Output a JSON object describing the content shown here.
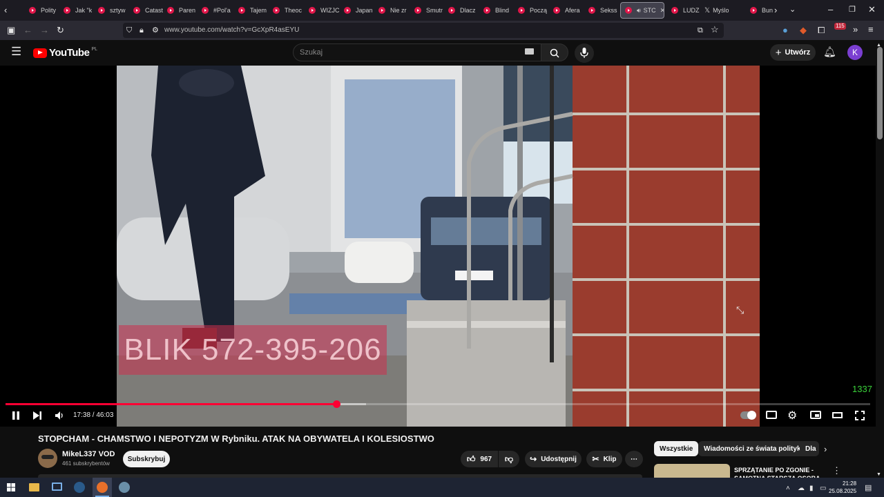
{
  "browser": {
    "tabs": [
      {
        "label": "Polity"
      },
      {
        "label": "Jak \"k"
      },
      {
        "label": "sztyw"
      },
      {
        "label": "Catast"
      },
      {
        "label": "Paren"
      },
      {
        "label": "#Pol'a"
      },
      {
        "label": "Tajem"
      },
      {
        "label": "Theoc"
      },
      {
        "label": "WIZJC"
      },
      {
        "label": "Japan"
      },
      {
        "label": "Nie zr"
      },
      {
        "label": "Smutr"
      },
      {
        "label": "Dlacz"
      },
      {
        "label": "Blind"
      },
      {
        "label": "Począ"
      },
      {
        "label": "Afera"
      },
      {
        "label": "Sekss"
      },
      {
        "label": "STC",
        "active": true
      },
      {
        "label": "LUDZ"
      },
      {
        "label": "Myślo"
      },
      {
        "label": "Bun"
      }
    ],
    "url": "www.youtube.com/watch?v=GcXpR4asEYU",
    "extension_badge": "115"
  },
  "youtube": {
    "logo_text": "YouTube",
    "logo_region": "PL",
    "search_placeholder": "Szukaj",
    "create_label": "Utwórz",
    "avatar_letter": "K"
  },
  "player": {
    "overlay_text": "BLIK 572-395-206",
    "corner_text": "1337",
    "current_time": "17:38",
    "duration": "46:03",
    "time_display": "17:38 / 46:03",
    "progress_fraction": 0.383,
    "buffered_fraction": 0.417
  },
  "video": {
    "title": "STOPCHAM - CHAMSTWO I NEPOTYZM W Rybniku. ATAK NA OBYWATELA I KOLESIOSTWO",
    "channel": "MikeL337 VOD",
    "subscribers": "461 subskrybentów",
    "subscribe_label": "Subskrybuj",
    "likes": "967",
    "share_label": "Udostępnij",
    "clip_label": "Klip"
  },
  "sidebar": {
    "chips": [
      {
        "label": "Wszystkie",
        "active": true
      },
      {
        "label": "Wiadomości ze świata polityki"
      },
      {
        "label": "Dla"
      }
    ],
    "recommendation_title": "SPRZĄTANIE PO ZGONIE - SAMOTNA STARSZA OSOBA"
  },
  "taskbar": {
    "time": "21:28",
    "date": "25.08.2025"
  },
  "colors": {
    "accent_red": "#ff0033",
    "brand_red": "#ff0000",
    "corner_green": "#3ad23a",
    "avatar_purple": "#7b3fd1"
  }
}
